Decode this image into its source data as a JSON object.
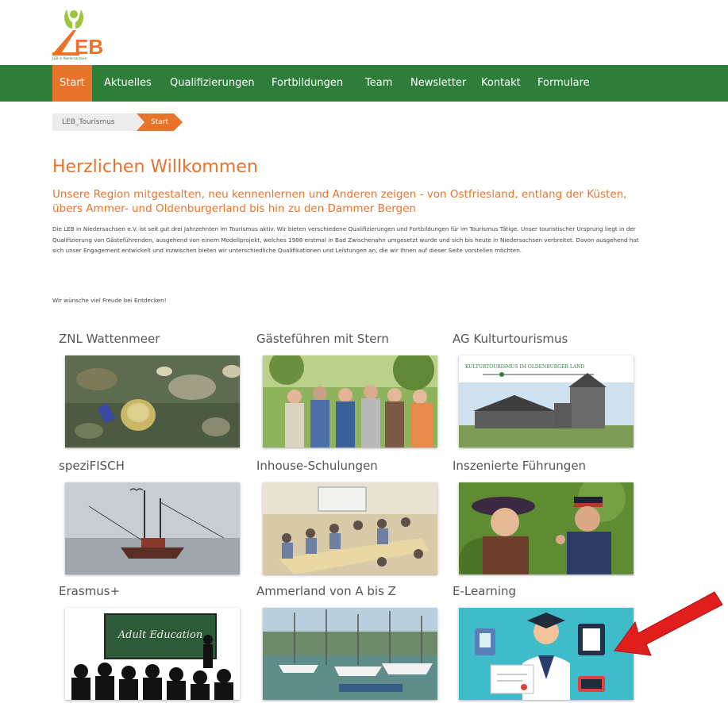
{
  "logo": {
    "text": "LEB",
    "small": "LEB in Niedersachsen"
  },
  "nav": {
    "items": [
      {
        "label": "Start",
        "active": true
      },
      {
        "label": "Aktuelles"
      },
      {
        "label": "Qualifizierungen"
      },
      {
        "label": "Fortbildungen"
      },
      {
        "label": "Team"
      },
      {
        "label": "Newsletter"
      },
      {
        "label": "Kontakt"
      },
      {
        "label": "Formulare"
      }
    ]
  },
  "breadcrumb": {
    "items": [
      "LEB_Tourismus",
      "Start"
    ]
  },
  "content": {
    "title": "Herzlichen Willkommen",
    "subtitle": "Unsere Region mitgestalten, neu kennenlernen und Anderen zeigen - von Ostfriesland, entlang der Küsten, übers Ammer- und Oldenburgerland bis hin zu den Dammer Bergen",
    "intro": "Die LEB in Niedersachsen e.V. ist seit gut drei Jahrzehnten im Tourismus aktiv. Wir bieten verschiedene Qualifizierungen und Fortbildungen für im Tourismus Tätige. Unser touristischer Ursprung liegt in der Qualifizierung von Gästeführenden, ausgehend von einem Modellprojekt, welches 1988 erstmal in Bad Zwischenahn umgesetzt wurde und sich bis heute in Niedersachsen verbreitet. Davon ausgehend hat sich unser Engagement entwickelt und inzwischen bieten wir unterschiedliche Qualifikationen und Leistungen an, die wir Ihnen auf dieser Seite vorstellen möchten.",
    "closing": "Wir wünsche viel Freude bei Entdecken!"
  },
  "tiles": [
    {
      "title": "ZNL Wattenmeer",
      "image": "mudflat-shells-photo"
    },
    {
      "title": "Gästeführen mit Stern",
      "image": "tour-group-photo"
    },
    {
      "title": "AG Kulturtourismus",
      "image": "church-photo",
      "banner": "KULTURTOURISMUS IM OLDENBURGER LAND"
    },
    {
      "title": "speziFISCH",
      "image": "fishing-boat-photo"
    },
    {
      "title": "Inhouse-Schulungen",
      "image": "seminar-room-photo"
    },
    {
      "title": "Inszenierte Führungen",
      "image": "costumed-guides-photo"
    },
    {
      "title": "Erasmus+",
      "image": "adult-education-graphic",
      "board": "Adult Education"
    },
    {
      "title": "Ammerland von A bis Z",
      "image": "harbor-boats-photo"
    },
    {
      "title": "E-Learning",
      "image": "e-learning-graphic"
    }
  ],
  "colors": {
    "accent": "#e8742b",
    "nav": "#2f7d3a",
    "arrow": "#e01e1e"
  }
}
